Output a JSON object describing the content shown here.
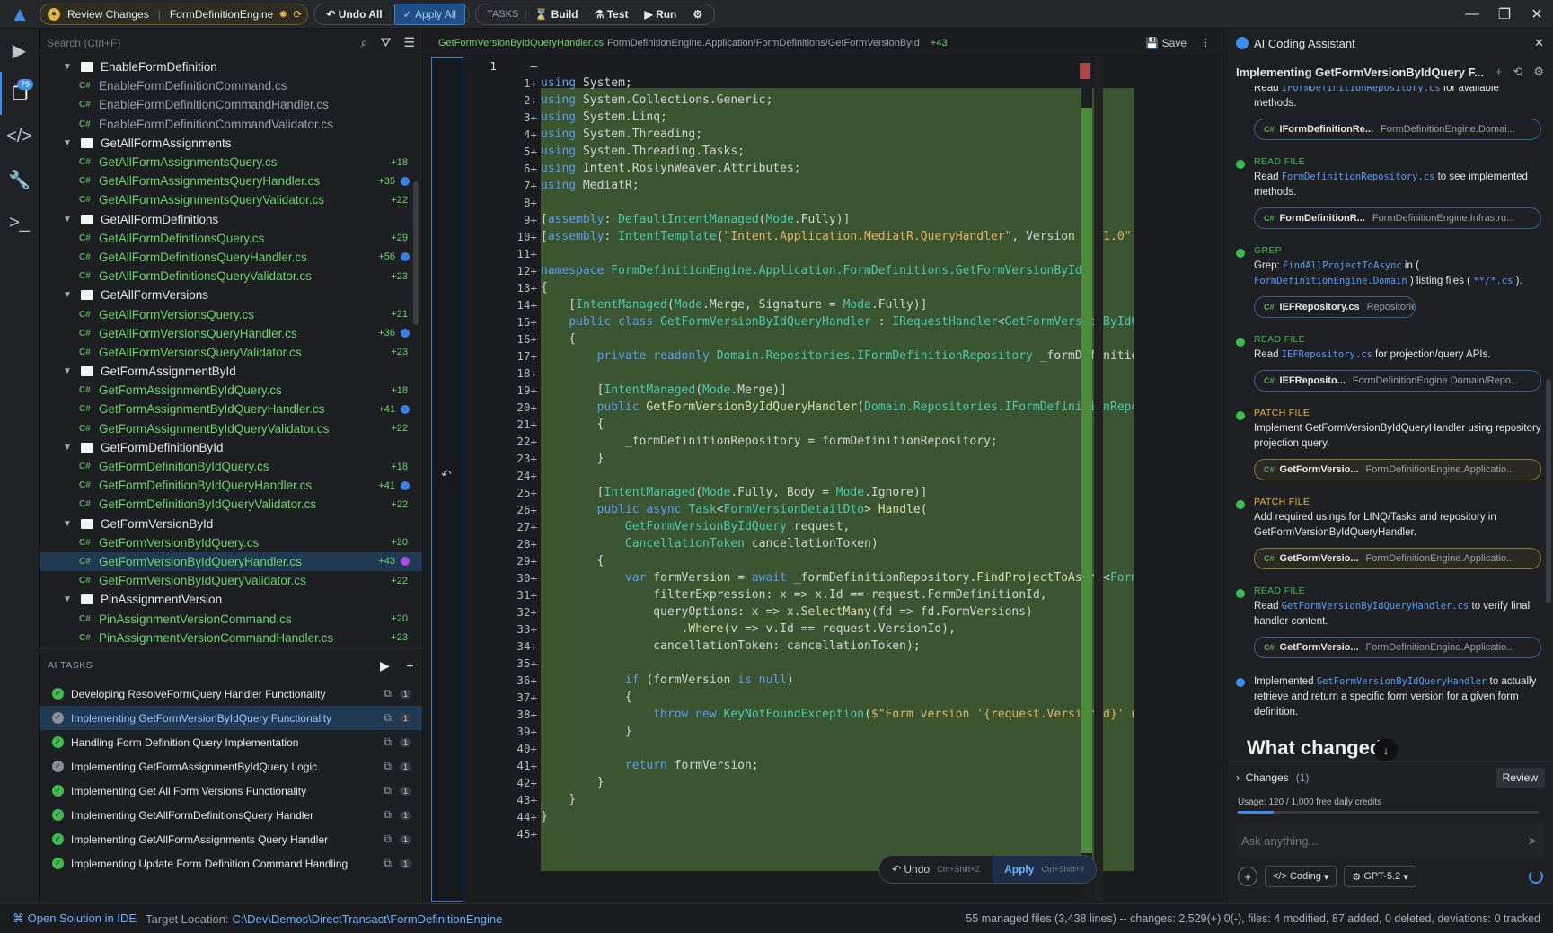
{
  "topbar": {
    "review_label": "Review Changes",
    "project": "FormDefinitionEngine",
    "undo_all": "Undo All",
    "apply_all": "Apply All",
    "tasks_label": "TASKS",
    "build": "Build",
    "test": "Test",
    "run": "Run"
  },
  "activity": {
    "badge": "79"
  },
  "explorer": {
    "search_placeholder": "Search (Ctrl+F)",
    "rows": [
      {
        "t": "folder",
        "name": "EnableFormDefinition",
        "plain": true
      },
      {
        "t": "file",
        "name": "EnableFormDefinitionCommand.cs",
        "plain": true
      },
      {
        "t": "file",
        "name": "EnableFormDefinitionCommandHandler.cs",
        "plain": true
      },
      {
        "t": "file",
        "name": "EnableFormDefinitionCommandValidator.cs",
        "plain": true
      },
      {
        "t": "folder",
        "name": "GetAllFormAssignments"
      },
      {
        "t": "file",
        "name": "GetAllFormAssignmentsQuery.cs",
        "count": "+18"
      },
      {
        "t": "file",
        "name": "GetAllFormAssignmentsQueryHandler.cs",
        "count": "+35",
        "dot": "blue"
      },
      {
        "t": "file",
        "name": "GetAllFormAssignmentsQueryValidator.cs",
        "count": "+22"
      },
      {
        "t": "folder",
        "name": "GetAllFormDefinitions"
      },
      {
        "t": "file",
        "name": "GetAllFormDefinitionsQuery.cs",
        "count": "+29"
      },
      {
        "t": "file",
        "name": "GetAllFormDefinitionsQueryHandler.cs",
        "count": "+56",
        "dot": "blue"
      },
      {
        "t": "file",
        "name": "GetAllFormDefinitionsQueryValidator.cs",
        "count": "+23"
      },
      {
        "t": "folder",
        "name": "GetAllFormVersions"
      },
      {
        "t": "file",
        "name": "GetAllFormVersionsQuery.cs",
        "count": "+21"
      },
      {
        "t": "file",
        "name": "GetAllFormVersionsQueryHandler.cs",
        "count": "+36",
        "dot": "blue"
      },
      {
        "t": "file",
        "name": "GetAllFormVersionsQueryValidator.cs",
        "count": "+23"
      },
      {
        "t": "folder",
        "name": "GetFormAssignmentById"
      },
      {
        "t": "file",
        "name": "GetFormAssignmentByIdQuery.cs",
        "count": "+18"
      },
      {
        "t": "file",
        "name": "GetFormAssignmentByIdQueryHandler.cs",
        "count": "+41",
        "dot": "blue"
      },
      {
        "t": "file",
        "name": "GetFormAssignmentByIdQueryValidator.cs",
        "count": "+22"
      },
      {
        "t": "folder",
        "name": "GetFormDefinitionById"
      },
      {
        "t": "file",
        "name": "GetFormDefinitionByIdQuery.cs",
        "count": "+18"
      },
      {
        "t": "file",
        "name": "GetFormDefinitionByIdQueryHandler.cs",
        "count": "+41",
        "dot": "blue"
      },
      {
        "t": "file",
        "name": "GetFormDefinitionByIdQueryValidator.cs",
        "count": "+22"
      },
      {
        "t": "folder",
        "name": "GetFormVersionById"
      },
      {
        "t": "file",
        "name": "GetFormVersionByIdQuery.cs",
        "count": "+20"
      },
      {
        "t": "file",
        "name": "GetFormVersionByIdQueryHandler.cs",
        "count": "+43",
        "dot": "purple",
        "sel": true
      },
      {
        "t": "file",
        "name": "GetFormVersionByIdQueryValidator.cs",
        "count": "+22"
      },
      {
        "t": "folder",
        "name": "PinAssignmentVersion"
      },
      {
        "t": "file",
        "name": "PinAssignmentVersionCommand.cs",
        "count": "+20"
      },
      {
        "t": "file",
        "name": "PinAssignmentVersionCommandHandler.cs",
        "count": "+23"
      }
    ]
  },
  "tasks": {
    "title": "AI TASKS",
    "items": [
      {
        "label": "Developing ResolveFormQuery Handler Functionality",
        "n": "1"
      },
      {
        "label": "Implementing GetFormVersionByIdQuery Functionality",
        "n": "1",
        "sel": true
      },
      {
        "label": "Handling Form Definition Query Implementation",
        "n": "1"
      },
      {
        "label": "Implementing GetFormAssignmentByIdQuery Logic",
        "n": "1"
      },
      {
        "label": "Implementing Get All Form Versions Functionality",
        "n": "1"
      },
      {
        "label": "Implementing GetAllFormDefinitionsQuery Handler",
        "n": "1"
      },
      {
        "label": "Implementing GetAllFormAssignments Query Handler",
        "n": "1"
      },
      {
        "label": "Implementing Update Form Definition Command Handling",
        "n": "1"
      }
    ]
  },
  "editor": {
    "filename": "GetFormVersionByIdQueryHandler.cs",
    "path": "FormDefinitionEngine.Application/FormDefinitions/GetFormVersionById",
    "plus": "+43",
    "save": "Save",
    "header_line": "1",
    "undo": "Undo",
    "undo_kb": "Ctrl+Shift+Z",
    "apply": "Apply",
    "apply_kb": "Ctrl+Shift+Y"
  },
  "chat": {
    "title": "AI Coding Assistant",
    "thread": "Implementing GetFormVersionByIdQuery F...",
    "what_changed": "What changed",
    "changes_label": "Changes",
    "changes_count": "(1)",
    "review": "Review",
    "usage": "Usage: 120 / 1,000 free daily credits",
    "usage_fraction": 0.12,
    "ask_placeholder": "Ask anything...",
    "mode": "Coding",
    "model": "GPT-5.2"
  },
  "status": {
    "open_ide": "Open Solution in IDE",
    "target_label": "Target Location:",
    "target": "C:\\Dev\\Demos\\DirectTransact\\FormDefinitionEngine",
    "summary": "55 managed files (3,438 lines) -- changes: 2,529(+) 0(-), files: 4 modified, 87 added, 0 deleted, deviations: 0 tracked"
  }
}
